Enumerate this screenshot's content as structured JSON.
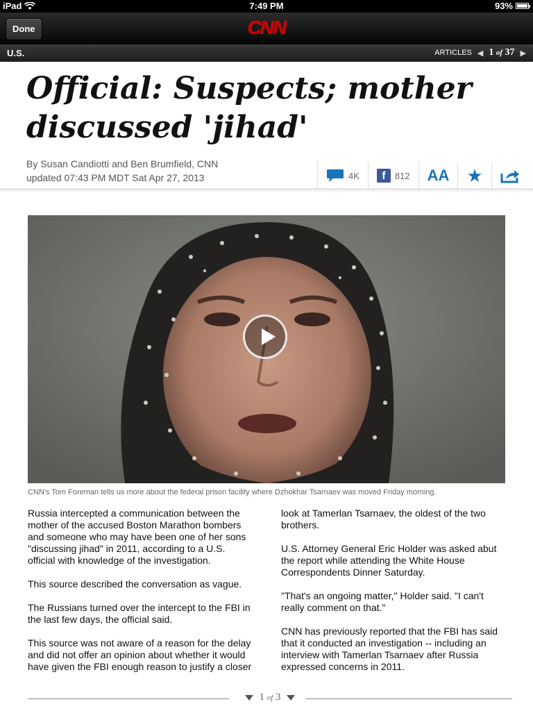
{
  "status": {
    "device": "iPad",
    "time": "7:49 PM",
    "battery": "93%",
    "battery_level": 0.93
  },
  "nav": {
    "done_label": "Done",
    "logo": "CNN"
  },
  "section": {
    "name": "U.S.",
    "articles_label": "ARTICLES",
    "current": "1",
    "of": "of",
    "total": "37"
  },
  "article": {
    "headline": "Official: Suspects; mother discussed 'jihad'",
    "byline": "By Susan Candiotti and Ben Brumfield, CNN",
    "updated": "updated 07:43 PM MDT Sat Apr 27, 2013"
  },
  "actions": {
    "comments_count": "4K",
    "facebook_count": "812",
    "font_label": "AA"
  },
  "video": {
    "caption": "CNN's Tom Foreman tells us more about the federal prison facility where Dzhokhar Tsarnaev was moved Friday morning."
  },
  "body": {
    "col1": [
      "Russia intercepted a communication between the mother of the accused Boston Marathon bombers and someone who may have been one of her sons \"discussing jihad\" in 2011, according to a U.S. official with knowledge of the investigation.",
      "This source described the conversation as vague.",
      "The Russians turned over the intercept to the FBI in the last few days, the official said.",
      "This source was not aware of a reason for the delay and did not offer an opinion about whether it would have given the FBI enough reason to justify a closer"
    ],
    "col2": [
      "look at Tamerlan Tsarnaev, the oldest of the two brothers.",
      "U.S. Attorney General Eric Holder was asked abut the report while attending the White House Correspondents Dinner Saturday.",
      "\"That's an ongoing matter,\" Holder said.  \"I can't really comment on that.\"",
      "CNN has previously reported that the FBI has said that it conducted an investigation -- including an interview with Tamerlan Tsarnaev after Russia expressed concerns in 2011."
    ]
  },
  "pagination": {
    "current": "1",
    "of": "of",
    "total": "3"
  }
}
